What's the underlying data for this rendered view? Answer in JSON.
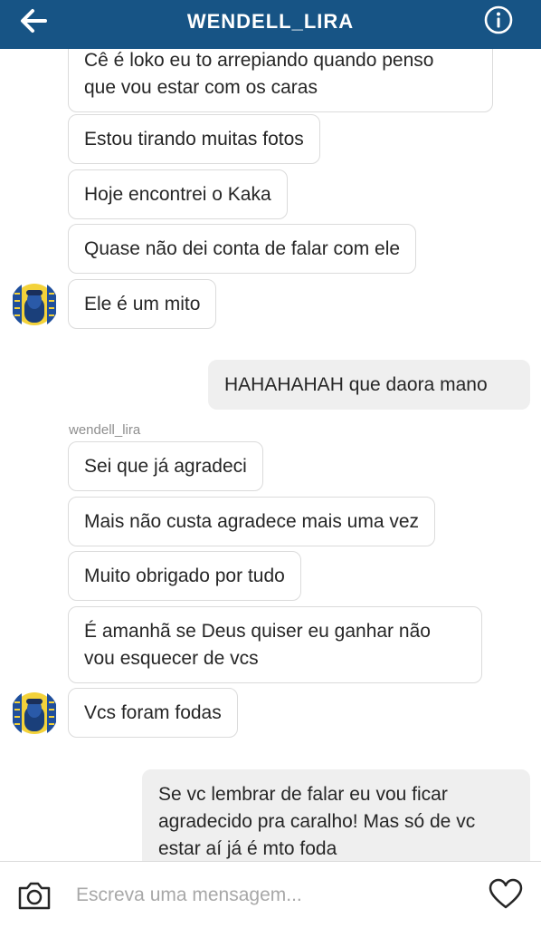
{
  "header": {
    "title": "WENDELL_LIRA",
    "back_icon": "arrow-left-icon",
    "info_icon": "info-circle-icon",
    "bg_color": "#175485"
  },
  "messages": [
    {
      "direction": "incoming",
      "lines": [
        "Cê é loko eu to arrepiando quando penso",
        "que vou estar com os caras"
      ]
    },
    {
      "direction": "incoming",
      "lines": [
        "Estou tirando muitas fotos"
      ]
    },
    {
      "direction": "incoming",
      "lines": [
        "Hoje encontrei o Kaka"
      ]
    },
    {
      "direction": "incoming",
      "lines": [
        "Quase não dei conta de falar com ele"
      ]
    },
    {
      "direction": "incoming",
      "lines": [
        "Ele é um mito"
      ]
    },
    {
      "direction": "outgoing",
      "lines": [
        "HAHAHAHAH que daora mano"
      ]
    },
    {
      "direction": "incoming",
      "sender": "wendell_lira",
      "lines": [
        "Sei que já agradeci"
      ]
    },
    {
      "direction": "incoming",
      "lines": [
        "Mais não custa agradece mais uma vez"
      ]
    },
    {
      "direction": "incoming",
      "lines": [
        "Muito obrigado por tudo"
      ]
    },
    {
      "direction": "incoming",
      "lines": [
        "É amanhã se Deus quiser eu ganhar não",
        "vou esquecer de vcs"
      ]
    },
    {
      "direction": "incoming",
      "lines": [
        "Vcs foram fodas"
      ]
    },
    {
      "direction": "outgoing",
      "lines": [
        "Se vc lembrar de falar eu vou ficar",
        "agradecido pra caralho! Mas só de vc",
        "estar aí já é mto foda"
      ]
    }
  ],
  "composer": {
    "placeholder": "Escreva uma mensagem...",
    "camera_icon": "camera-icon",
    "like_icon": "heart-icon"
  }
}
